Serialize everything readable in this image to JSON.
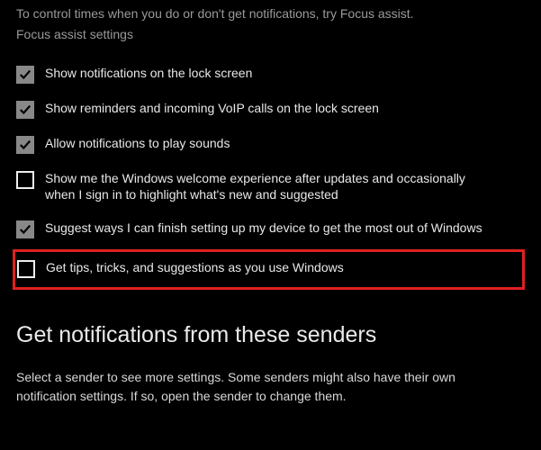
{
  "intro": "To control times when you do or don't get notifications, try Focus assist.",
  "focus_link": "Focus assist settings",
  "options": [
    {
      "checked": true,
      "label": "Show notifications on the lock screen"
    },
    {
      "checked": true,
      "label": "Show reminders and incoming VoIP calls on the lock screen"
    },
    {
      "checked": true,
      "label": "Allow notifications to play sounds"
    },
    {
      "checked": false,
      "label": "Show me the Windows welcome experience after updates and occasionally when I sign in to highlight what's new and suggested"
    },
    {
      "checked": true,
      "label": "Suggest ways I can finish setting up my device to get the most out of Windows"
    },
    {
      "checked": false,
      "label": "Get tips, tricks, and suggestions as you use Windows"
    }
  ],
  "senders_heading": "Get notifications from these senders",
  "senders_desc": "Select a sender to see more settings. Some senders might also have their own notification settings. If so, open the sender to change them."
}
